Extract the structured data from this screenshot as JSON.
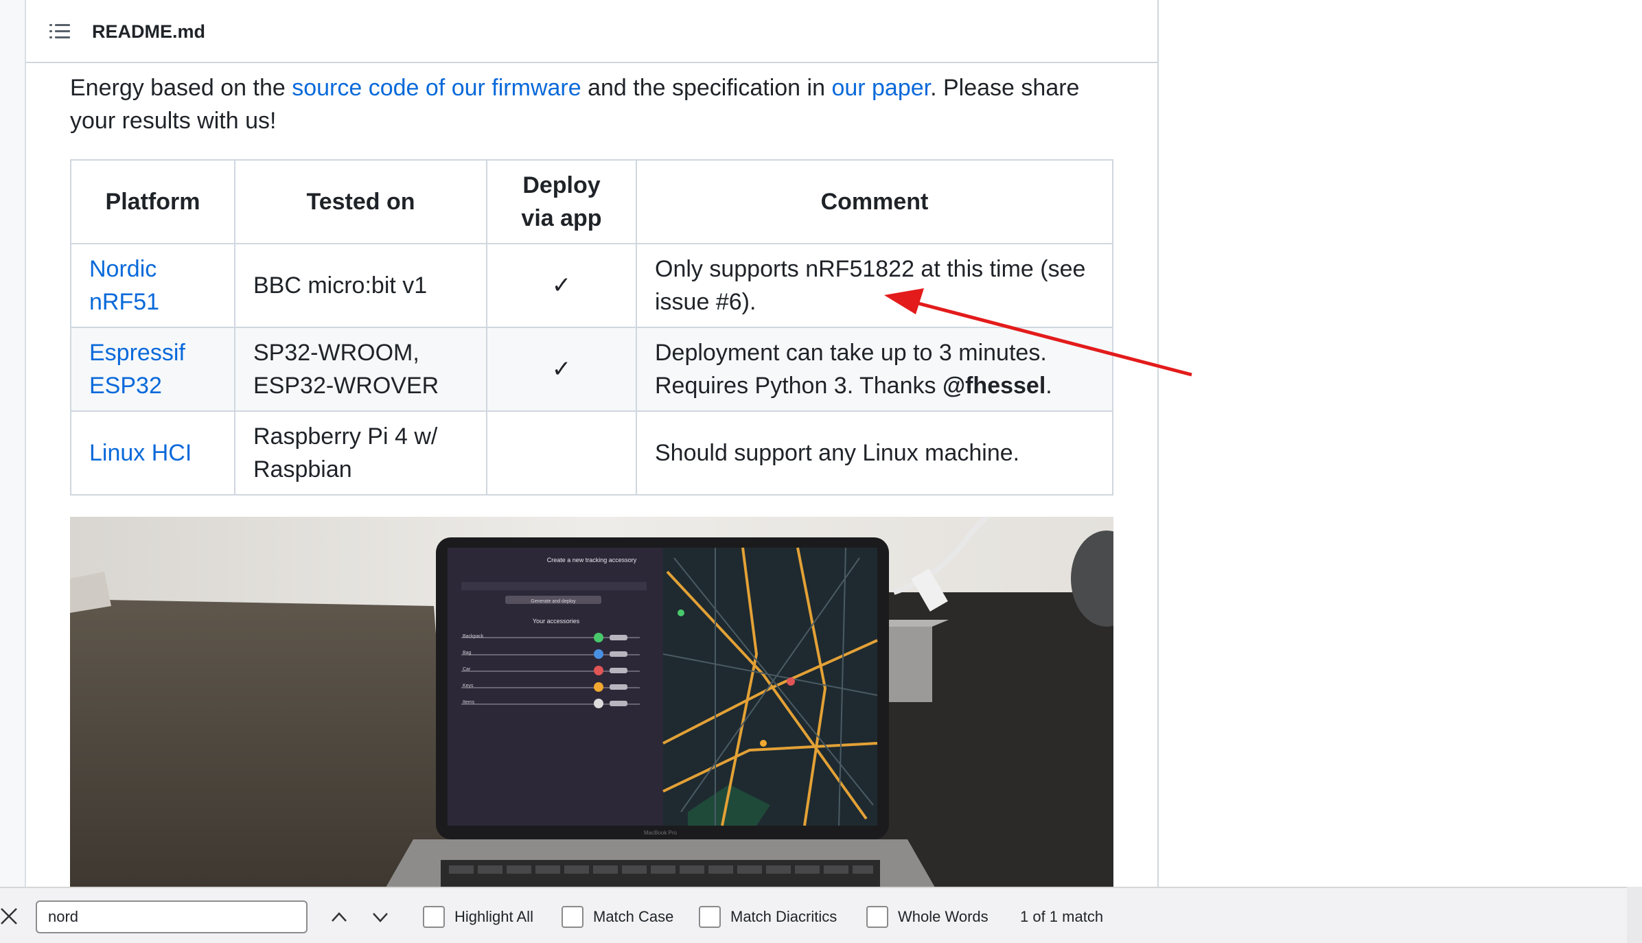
{
  "readme": {
    "title": "README.md",
    "icons": {
      "outline": "list-outline-icon"
    },
    "paragraph": {
      "text1": "Energy based on the ",
      "link1": "source code of our firmware",
      "text2": " and the specification in ",
      "link2": "our paper",
      "text3": ". Please share your results with us!"
    }
  },
  "table": {
    "headers": [
      "Platform",
      "Tested on",
      "Deploy via app",
      "Comment"
    ],
    "rows": [
      {
        "platform": "Nordic nRF51",
        "tested_on": "BBC micro:bit v1",
        "deploy": "✓",
        "comment": "Only supports nRF51822 at this time (see issue #6)."
      },
      {
        "platform": "Espressif ESP32",
        "tested_on": "SP32-WROOM, ESP32-WROVER",
        "deploy": "✓",
        "comment_prefix": "Deployment can take up to 3 minutes. Requires Python 3. Thanks ",
        "comment_user": "@fhessel",
        "comment_suffix": "."
      },
      {
        "platform": "Linux HCI",
        "tested_on": "Raspberry Pi 4 w/ Raspbian",
        "deploy": "",
        "comment": "Should support any Linux machine."
      }
    ]
  },
  "photo": {
    "screen_title": "Create a new tracking accessory",
    "generate_button": "Generate and deploy",
    "list_title": "Your accessories",
    "accessories": [
      "Backpack",
      "Bag",
      "Car",
      "Keys",
      "Items"
    ],
    "laptop_label": "MacBook Pro"
  },
  "findbar": {
    "query": "nord",
    "highlight_all": "Highlight All",
    "match_case": "Match Case",
    "match_diacritics": "Match Diacritics",
    "whole_words": "Whole Words",
    "status": "1 of 1 match"
  },
  "colors": {
    "link": "#0969da",
    "annotation_arrow": "#e31b1b",
    "table_border": "#d0d7de"
  }
}
